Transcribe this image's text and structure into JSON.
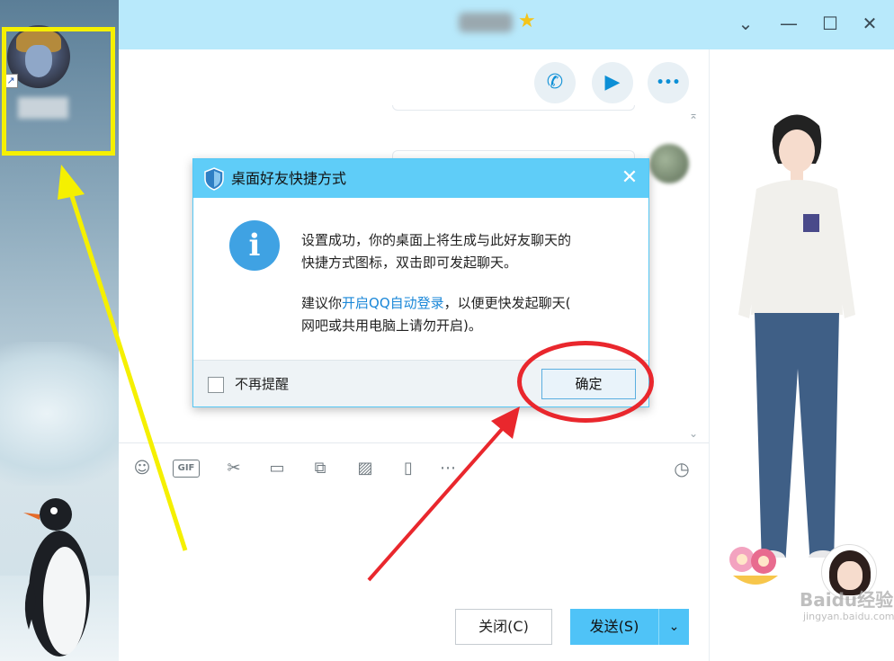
{
  "desktop": {
    "shortcut_arrow_glyph": "↗"
  },
  "window": {
    "title_badge_glyph": "★",
    "controls": {
      "minimize": "⌄",
      "maximize_min": "—",
      "maximize": "☐",
      "close": "✕"
    }
  },
  "chat_actions": {
    "voice_call_icon": "phone-icon",
    "video_call_icon": "video-icon",
    "more_icon": "more-icon",
    "voice_glyph": "✆",
    "video_glyph": "▶",
    "more_glyph": "•••"
  },
  "toolbar": {
    "emoji_glyph": "☺",
    "gif_label": "GIF",
    "screenshot_glyph": "✂",
    "folder_glyph": "▭",
    "file_glyph": "⧉",
    "image_glyph": "▨",
    "shake_glyph": "▯",
    "more_glyph": "⋯",
    "history_glyph": "◷"
  },
  "buttons": {
    "close_label": "关闭(C)",
    "send_label": "发送(S)",
    "send_drop_glyph": "⌄"
  },
  "dialog": {
    "title": "桌面好友快捷方式",
    "close_glyph": "✕",
    "info_glyph": "i",
    "message_line1": "设置成功，你的桌面上将生成与此好友聊天的",
    "message_line2": "快捷方式图标，双击即可发起聊天。",
    "suggest_prefix": "建议你",
    "suggest_link": "开启QQ自动登录",
    "suggest_suffix": "，以便更快发起聊天(",
    "suggest_line2": "网吧或共用电脑上请勿开启)。",
    "checkbox_label": "不再提醒",
    "ok_label": "确定"
  },
  "watermark": {
    "logo": "Baidu经验",
    "url": "jingyan.baidu.com"
  },
  "colors": {
    "titlebar": "#b8e9fb",
    "dialog_header": "#5fcdf8",
    "send_button": "#4fc3f7",
    "link": "#1a87d8",
    "annotation_red": "#e9272d",
    "annotation_yellow": "#f5f000"
  }
}
